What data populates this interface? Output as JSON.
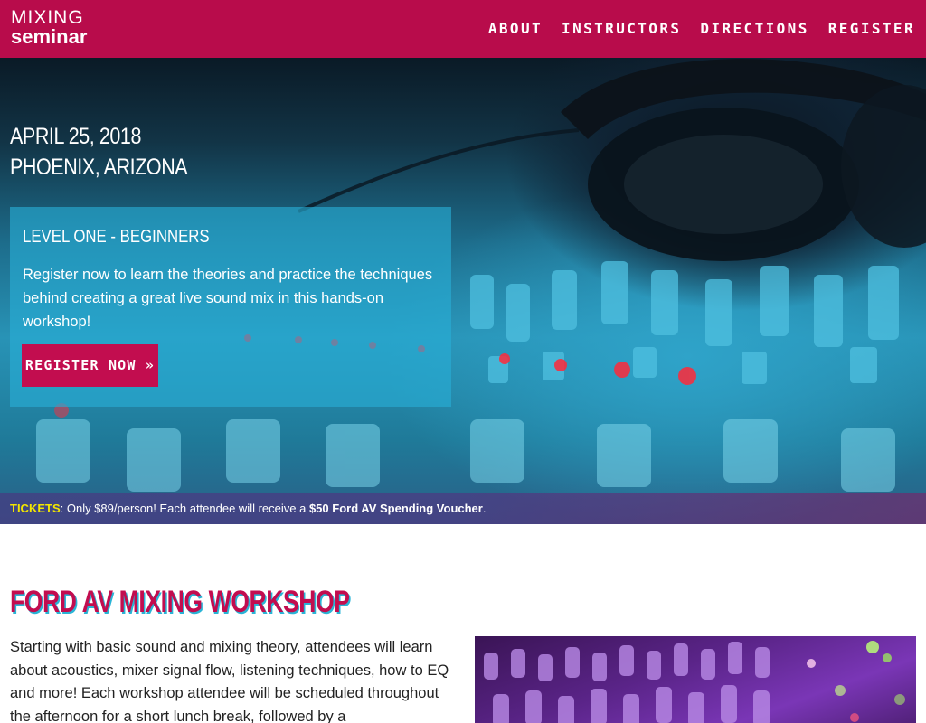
{
  "logo": {
    "top": "MIXING",
    "bottom": "seminar"
  },
  "nav": {
    "items": [
      "ABOUT",
      "INSTRUCTORS",
      "DIRECTIONS",
      "REGISTER"
    ]
  },
  "hero": {
    "date": "APRIL 25, 2018",
    "location": "PHOENIX, ARIZONA",
    "promo": {
      "title": "LEVEL ONE - BEGINNERS",
      "text": "Register now to learn the theories and practice the techniques behind creating a great live sound mix in this hands-on workshop!",
      "button": "REGISTER NOW »"
    }
  },
  "tickets": {
    "label": "TICKETS",
    "text_before": ": Only $89/person! Each attendee will receive a ",
    "strong": "$50 Ford AV Spending Voucher",
    "text_after": "."
  },
  "workshop": {
    "title": "FORD AV MIXING WORKSHOP",
    "body": "Starting with basic sound and mixing theory, attendees will learn about acoustics, mixer signal flow, listening techniques, how to EQ and more! Each workshop attendee will be scheduled throughout the afternoon for a short lunch break, followed by a"
  },
  "colors": {
    "brand": "#b80c4b",
    "button": "#c20d4f",
    "tickets_label": "#f2e600",
    "title_shadow": "#2ab4d6"
  }
}
